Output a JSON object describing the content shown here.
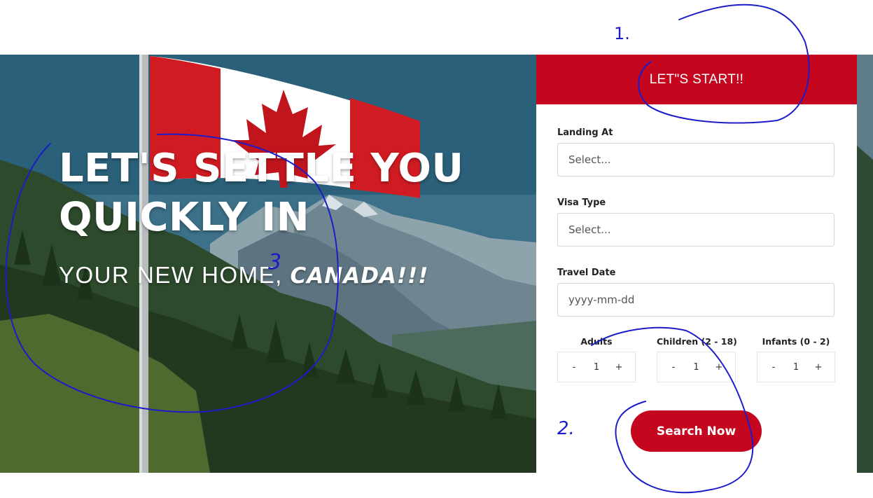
{
  "hero": {
    "title_line1": "LET'S SETTLE YOU",
    "title_line2": "QUICKLY IN",
    "subtitle_main": "YOUR NEW HOME, ",
    "subtitle_accent": "CANADA!!!"
  },
  "form": {
    "header": "LET\"S START!!",
    "landing_label": "Landing At",
    "landing_value": "Select...",
    "visa_label": "Visa Type",
    "visa_value": "Select...",
    "date_label": "Travel Date",
    "date_placeholder": "yyyy-mm-dd",
    "adults": {
      "label": "Adults",
      "minus": "-",
      "value": "1",
      "plus": "+"
    },
    "children": {
      "label": "Children (2 - 18)",
      "minus": "-",
      "value": "1",
      "plus": "+"
    },
    "infants": {
      "label": "Infants (0 - 2)",
      "minus": "-",
      "value": "1",
      "plus": "+"
    },
    "search_label": "Search Now"
  },
  "annotations": {
    "mark_1": "1.",
    "mark_2": "2.",
    "mark_3": "3",
    "ink_color": "#1c1cc8"
  },
  "colors": {
    "brand_red": "#c4071f",
    "white": "#ffffff"
  }
}
